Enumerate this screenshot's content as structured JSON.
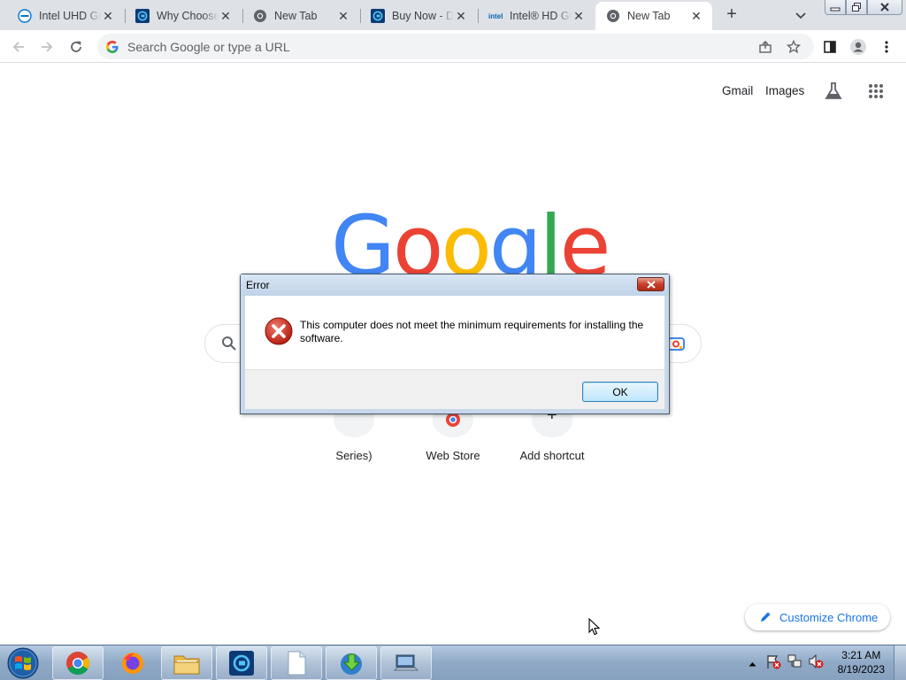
{
  "tabs": [
    {
      "title": "Intel UHD Graphics",
      "icon": "dell-icon"
    },
    {
      "title": "Why Choose",
      "icon": "driver-easy-icon"
    },
    {
      "title": "New Tab",
      "icon": "chrome-icon"
    },
    {
      "title": "Buy Now - Driver Easy",
      "icon": "driver-easy-icon"
    },
    {
      "title": "Intel® HD Graphics",
      "icon": "intel-icon"
    },
    {
      "title": "New Tab",
      "icon": "chrome-icon",
      "active": true
    }
  ],
  "omnibox": {
    "placeholder": "Search Google or type a URL"
  },
  "ntp": {
    "gmail": "Gmail",
    "images": "Images",
    "logo_letters": [
      "G",
      "o",
      "o",
      "g",
      "l",
      "e"
    ],
    "logo_colors": [
      "#4285f4",
      "#ea4335",
      "#fbbc05",
      "#4285f4",
      "#34a853",
      "#ea4335"
    ],
    "shortcuts": [
      "Series)",
      "Web Store",
      "Add shortcut"
    ],
    "customize": "Customize Chrome"
  },
  "dialog": {
    "title": "Error",
    "message": "This computer does not meet the minimum requirements for installing the software.",
    "ok": "OK"
  },
  "taskbar": {
    "apps": [
      "chrome-icon",
      "firefox-icon",
      "file-explorer-icon",
      "driver-easy-icon",
      "blank-document-icon",
      "installer-icon",
      "computer-icon"
    ],
    "time": "3:21 AM",
    "date": "8/19/2023"
  }
}
